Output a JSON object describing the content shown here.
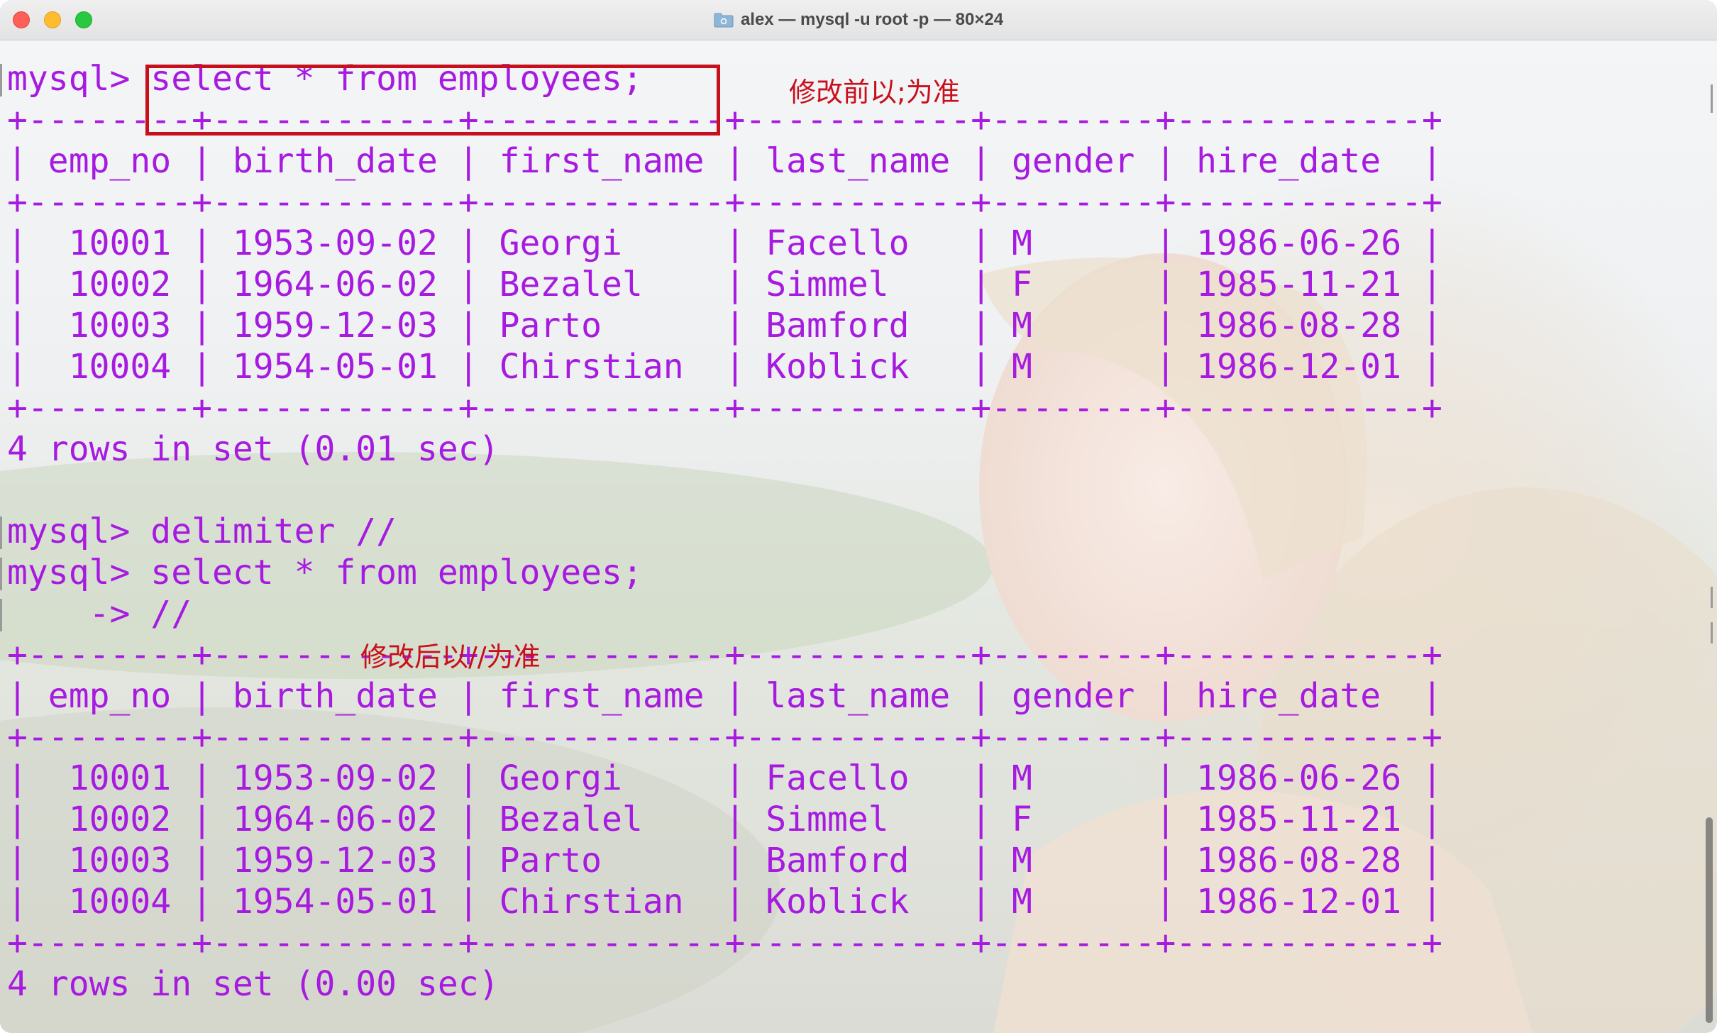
{
  "window": {
    "title": "alex — mysql -u root -p — 80×24",
    "title_icon": "folder-icon"
  },
  "colors": {
    "terminal_text": "#a71ae0",
    "annotation": "#c8101c"
  },
  "annotations": {
    "before": "修改前以;为准",
    "after": "修改后以//为准"
  },
  "terminal": {
    "lines": [
      "mysql> select * from employees;",
      "+--------+------------+------------+-----------+--------+------------+",
      "| emp_no | birth_date | first_name | last_name | gender | hire_date  |",
      "+--------+------------+------------+-----------+--------+------------+",
      "|  10001 | 1953-09-02 | Georgi     | Facello   | M      | 1986-06-26 |",
      "|  10002 | 1964-06-02 | Bezalel    | Simmel    | F      | 1985-11-21 |",
      "|  10003 | 1959-12-03 | Parto      | Bamford   | M      | 1986-08-28 |",
      "|  10004 | 1954-05-01 | Chirstian  | Koblick   | M      | 1986-12-01 |",
      "+--------+------------+------------+-----------+--------+------------+",
      "4 rows in set (0.01 sec)",
      "",
      "mysql> delimiter //",
      "mysql> select * from employees;",
      "    -> //",
      "+--------+------------+------------+-----------+--------+------------+",
      "| emp_no | birth_date | first_name | last_name | gender | hire_date  |",
      "+--------+------------+------------+-----------+--------+------------+",
      "|  10001 | 1953-09-02 | Georgi     | Facello   | M      | 1986-06-26 |",
      "|  10002 | 1964-06-02 | Bezalel    | Simmel    | F      | 1985-11-21 |",
      "|  10003 | 1959-12-03 | Parto      | Bamford   | M      | 1986-08-28 |",
      "|  10004 | 1954-05-01 | Chirstian  | Koblick   | M      | 1986-12-01 |",
      "+--------+------------+------------+-----------+--------+------------+",
      "4 rows in set (0.00 sec)"
    ]
  }
}
